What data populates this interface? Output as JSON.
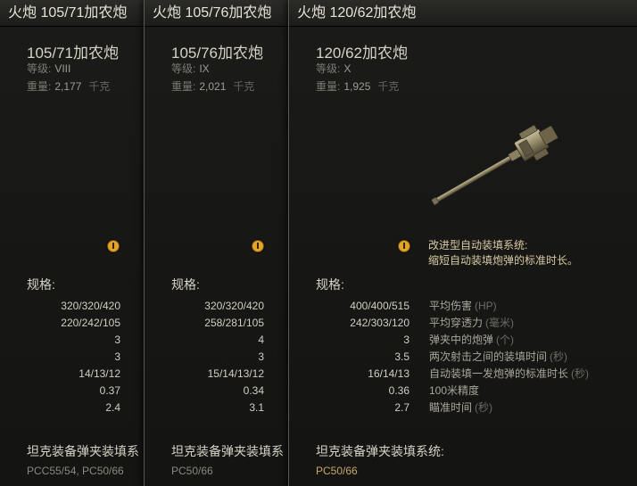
{
  "panels": [
    {
      "header": "火炮 105/71加农炮",
      "name": "105/71加农炮",
      "tier_label": "等级:",
      "tier": "VIII",
      "weight_label": "重量:",
      "weight": "2,177",
      "weight_unit": "千克",
      "specs_title": "规格:",
      "spec_values": [
        "320/320/420",
        "220/242/105",
        "3",
        "3",
        "14/13/12",
        "0.37",
        "2.4"
      ],
      "clip_title": "坦克装备弹夹装填系",
      "clip_tanks": "PCC55/54, PC50/66",
      "clip_color": "#8a877e"
    },
    {
      "header": "火炮 105/76加农炮",
      "name": "105/76加农炮",
      "tier_label": "等级:",
      "tier": "IX",
      "weight_label": "重量:",
      "weight": "2,021",
      "weight_unit": "千克",
      "specs_title": "规格:",
      "spec_values": [
        "320/320/420",
        "258/281/105",
        "4",
        "3",
        "15/14/13/12",
        "0.34",
        "3.1"
      ],
      "clip_title": "坦克装备弹夹装填系",
      "clip_tanks": "PC50/66",
      "clip_color": "#8a877e"
    },
    {
      "header": "火炮 120/62加农炮",
      "name": "120/62加农炮",
      "tier_label": "等级:",
      "tier": "X",
      "weight_label": "重量:",
      "weight": "1,925",
      "weight_unit": "千克",
      "feature_line1": "改进型自动装填系统:",
      "feature_line2": "缩短自动装填炮弹的标准时长。",
      "specs_title": "规格:",
      "specs": [
        {
          "value": "400/400/515",
          "label": "平均伤害",
          "unit": "(HP)"
        },
        {
          "value": "242/303/120",
          "label": "平均穿透力",
          "unit": "(毫米)"
        },
        {
          "value": "3",
          "label": "弹夹中的炮弹",
          "unit": "(个)"
        },
        {
          "value": "3.5",
          "label": "两次射击之间的装填时间",
          "unit": "(秒)"
        },
        {
          "value": "16/14/13",
          "label": "自动装填一发炮弹的标准时长",
          "unit": "(秒)"
        },
        {
          "value": "0.36",
          "label": "100米精度",
          "unit": ""
        },
        {
          "value": "2.7",
          "label": "瞄准时间",
          "unit": "(秒)"
        }
      ],
      "clip_title": "坦克装备弹夹装填系统:",
      "clip_tanks": "PC50/66",
      "clip_color": "#c8a86a"
    }
  ],
  "icons": {
    "feature": "exclamation-circle-icon",
    "gun": "gun-barrel-icon"
  },
  "colors": {
    "accent_orange": "#e2a52c",
    "feature_text": "#d8c9a4"
  }
}
